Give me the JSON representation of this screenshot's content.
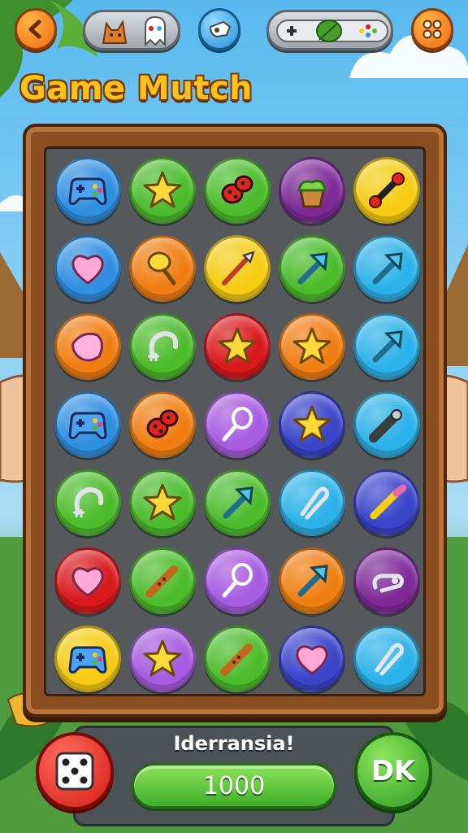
{
  "title": "Game Mutch",
  "top_bar": {
    "back_icon": "chevron-left-icon",
    "avatar_pill_icons": [
      "fox-icon",
      "ghost-gamepad-icon"
    ],
    "powerup_icon": "whistle-icon",
    "controller_pill_icon": "leaf-icon",
    "menu_icon": "four-dots-icon"
  },
  "colors": {
    "blue": "#2f8fe0",
    "green": "#4cbc2c",
    "purple": "#7d2a98",
    "yellow": "#f5cc12",
    "orange": "#f07e12",
    "red": "#d9181c",
    "sky": "#2cb2e8",
    "lavender": "#a65be0",
    "indigo": "#3944c9",
    "board_wood": "#8b4e22",
    "board_inner": "#55595c"
  },
  "board": {
    "rows": [
      [
        {
          "color": "blue",
          "icon": "gamepad-icon"
        },
        {
          "color": "green",
          "icon": "star-icon"
        },
        {
          "color": "green",
          "icon": "ladybug-icon"
        },
        {
          "color": "purple",
          "icon": "plant-pot-icon"
        },
        {
          "color": "yellow",
          "icon": "dumbbell-icon"
        }
      ],
      [
        {
          "color": "blue",
          "icon": "heart-icon"
        },
        {
          "color": "orange",
          "icon": "key-icon"
        },
        {
          "color": "yellow",
          "icon": "spear-icon"
        },
        {
          "color": "green",
          "icon": "arrow-icon"
        },
        {
          "color": "sky",
          "icon": "arrow-icon"
        }
      ],
      [
        {
          "color": "orange",
          "icon": "gem-icon"
        },
        {
          "color": "green",
          "icon": "hook-icon"
        },
        {
          "color": "red",
          "icon": "star-icon"
        },
        {
          "color": "orange",
          "icon": "star-icon"
        },
        {
          "color": "sky",
          "icon": "arrow-icon"
        }
      ],
      [
        {
          "color": "blue",
          "icon": "gamepad-icon"
        },
        {
          "color": "orange",
          "icon": "ladybug-icon"
        },
        {
          "color": "lavender",
          "icon": "rattle-icon"
        },
        {
          "color": "indigo",
          "icon": "star-icon"
        },
        {
          "color": "sky",
          "icon": "flashlight-icon"
        }
      ],
      [
        {
          "color": "green",
          "icon": "hook-icon"
        },
        {
          "color": "green",
          "icon": "star-icon"
        },
        {
          "color": "green",
          "icon": "arrow-icon"
        },
        {
          "color": "sky",
          "icon": "paperclip-icon"
        },
        {
          "color": "indigo",
          "icon": "pencil-icon"
        }
      ],
      [
        {
          "color": "red",
          "icon": "heart-icon"
        },
        {
          "color": "green",
          "icon": "flute-icon"
        },
        {
          "color": "lavender",
          "icon": "rattle-icon"
        },
        {
          "color": "orange",
          "icon": "arrow-icon"
        },
        {
          "color": "purple",
          "icon": "safety-pin-icon"
        }
      ],
      [
        {
          "color": "yellow",
          "icon": "gamepad-icon"
        },
        {
          "color": "lavender",
          "icon": "star-icon"
        },
        {
          "color": "green",
          "icon": "flute-icon"
        },
        {
          "color": "indigo",
          "icon": "heart-icon"
        },
        {
          "color": "sky",
          "icon": "paperclip-icon"
        }
      ]
    ]
  },
  "bottom_panel": {
    "label": "Iderransia!",
    "score": "1000",
    "dice_icon": "dice-icon",
    "ok_label": "DK"
  }
}
